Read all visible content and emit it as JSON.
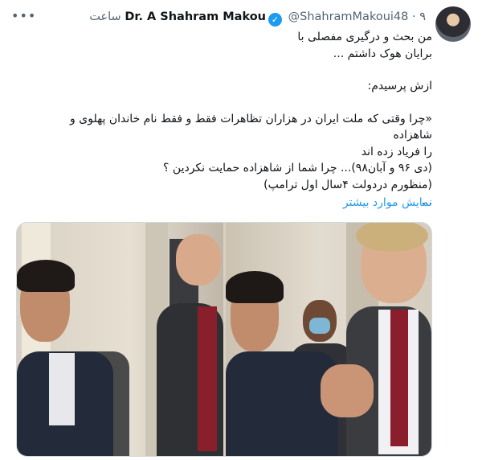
{
  "author": {
    "display_name": "Dr. A Shahram Makou",
    "handle": "@ShahramMakoui48",
    "separator": "·",
    "time": "۹ ساعت",
    "verified_icon": "verified-badge-icon"
  },
  "colors": {
    "link": "#1d9bf0",
    "text": "#0f1419",
    "muted": "#536471",
    "border": "#cfd9de"
  },
  "tweet": {
    "lines": [
      "من بحث و درگیری مفصلی با",
      "برایان هوک داشتم ...",
      "ازش پرسیدم:",
      "«چرا وقتی که ملت ایران در هزاران تظاهرات فقط و فقط نام خاندان پهلوی و شاهزاده",
      "را فریاد زده اند",
      "(دی ۹۶ و آبان۹۸)... چرا شما از شاهزاده حمایت نکردین ؟",
      "(منظورم دردولت ۴سال اول ترامپ)",
      "..."
    ],
    "show_more": "نمایش موارد بیشتر"
  },
  "media": {
    "count": 2,
    "items": [
      "photo-left",
      "photo-right"
    ]
  }
}
